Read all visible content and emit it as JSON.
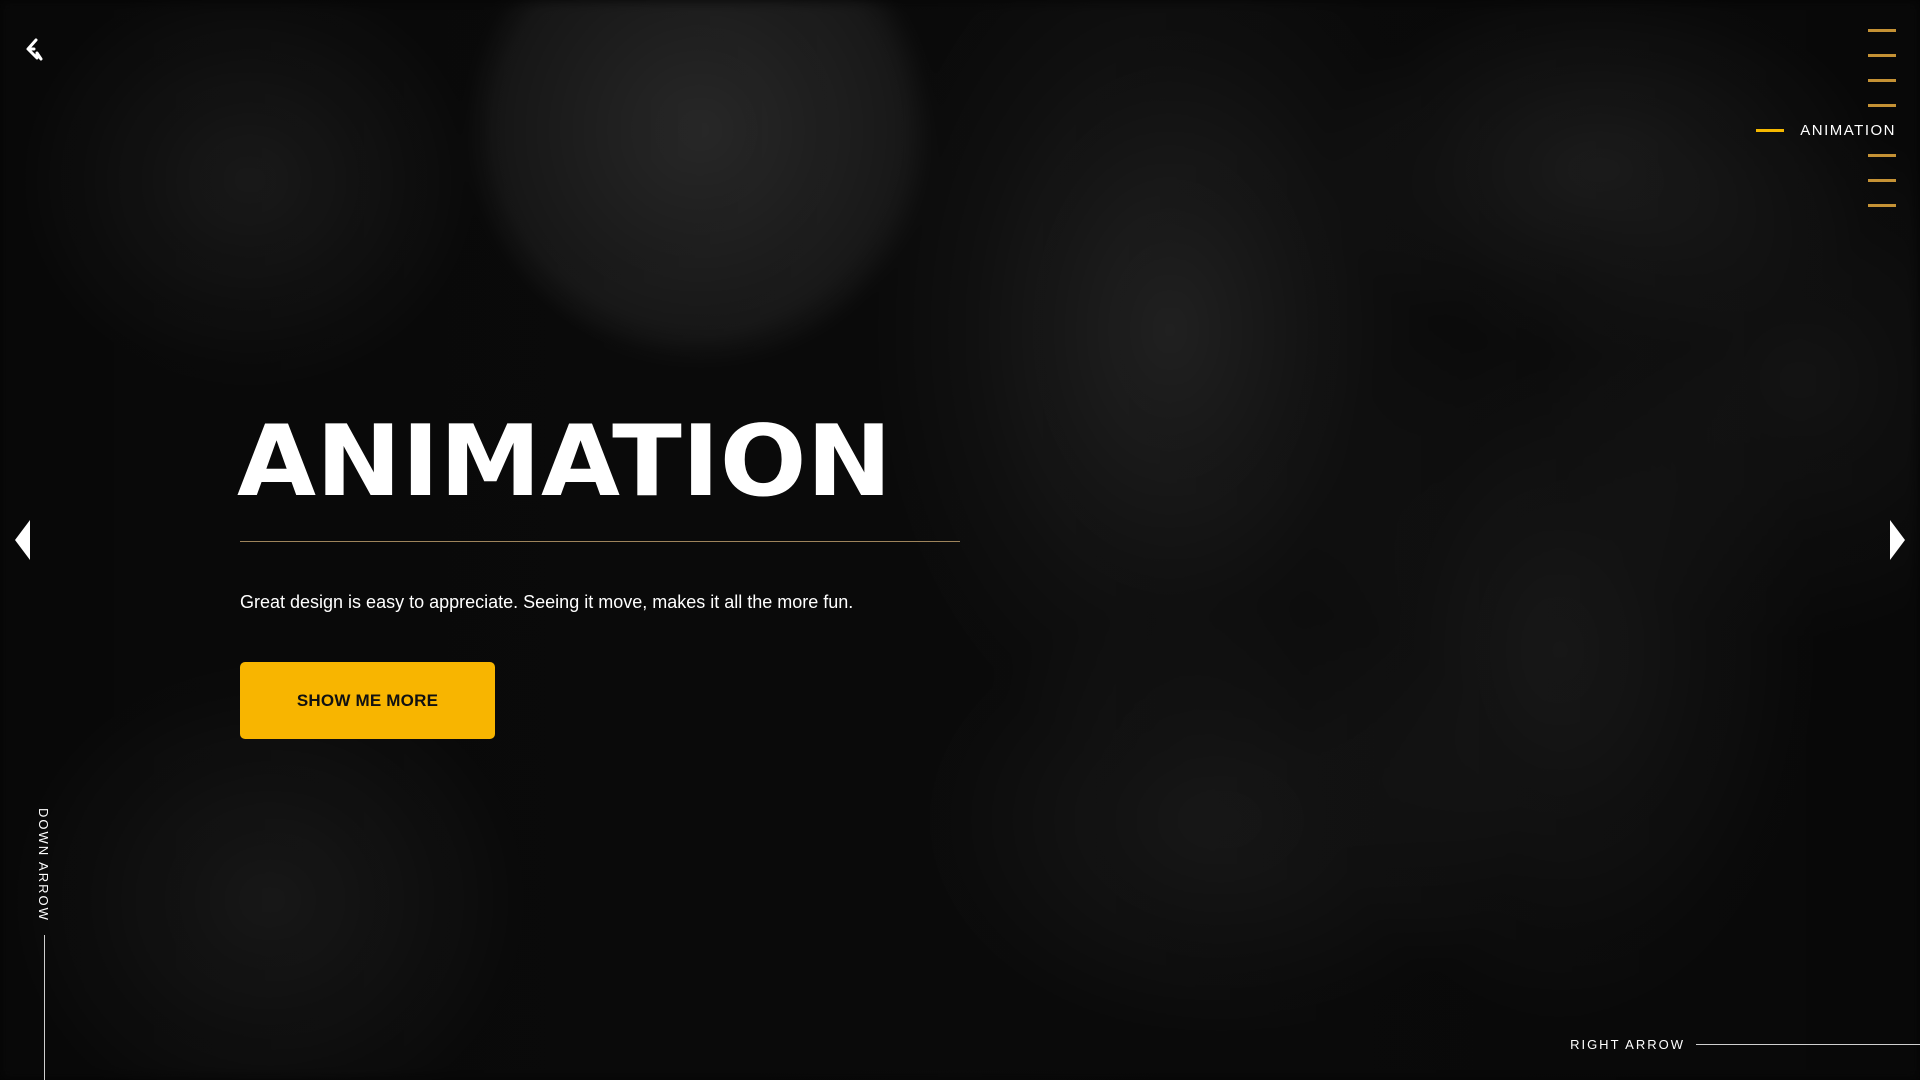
{
  "colors": {
    "accent": "#f8b500",
    "nav_dash": "#d9a13a",
    "divider": "#b99a6a",
    "background": "#050505"
  },
  "nav": {
    "back_icon": "back-arrow-icon",
    "sections": [
      {
        "label": ""
      },
      {
        "label": ""
      },
      {
        "label": ""
      },
      {
        "label": ""
      },
      {
        "label": "ANIMATION",
        "active": true
      },
      {
        "label": ""
      },
      {
        "label": ""
      },
      {
        "label": ""
      }
    ]
  },
  "hero": {
    "title": "ANIMATION",
    "description": "Great design is easy to appreciate. Seeing it move, makes it all the more fun.",
    "cta_label": "SHOW ME MORE"
  },
  "arrows": {
    "left_icon": "triangle-left-icon",
    "right_icon": "triangle-right-icon",
    "down_label": "DOWN ARROW",
    "right_label": "RIGHT ARROW"
  }
}
